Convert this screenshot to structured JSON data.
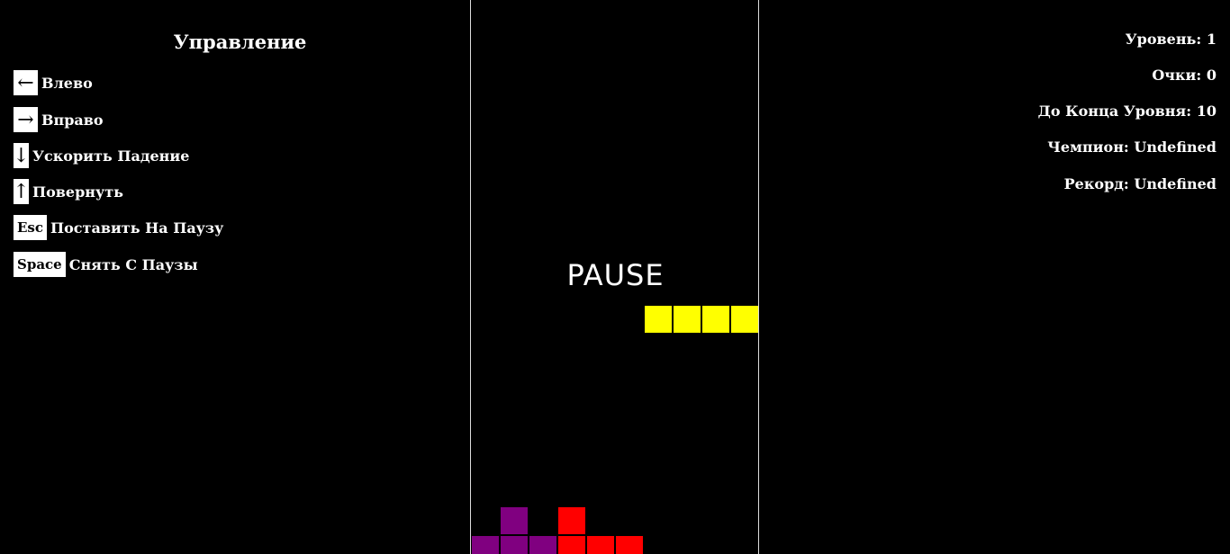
{
  "controls": {
    "title": "Управление",
    "items": [
      {
        "key": "←",
        "label": "Влево"
      },
      {
        "key": "→",
        "label": "Вправо"
      },
      {
        "key": "↓",
        "label": "Ускорить Падение"
      },
      {
        "key": "↑",
        "label": "Повернуть"
      },
      {
        "key": "Esc",
        "label": "Поставить На Паузу"
      },
      {
        "key": "Space",
        "label": "Снять С Паузы"
      }
    ]
  },
  "board": {
    "status": "PAUSE",
    "columns": 10,
    "cells": [
      {
        "col": 6,
        "row": 10.6,
        "color": "#ffff00"
      },
      {
        "col": 7,
        "row": 10.6,
        "color": "#ffff00"
      },
      {
        "col": 8,
        "row": 10.6,
        "color": "#ffff00"
      },
      {
        "col": 9,
        "row": 10.6,
        "color": "#ffff00"
      },
      {
        "col": 1,
        "row": 17.6,
        "color": "#800080"
      },
      {
        "col": 3,
        "row": 17.6,
        "color": "#ff0000"
      },
      {
        "col": 0,
        "row": 18.6,
        "color": "#800080"
      },
      {
        "col": 1,
        "row": 18.6,
        "color": "#800080"
      },
      {
        "col": 2,
        "row": 18.6,
        "color": "#800080"
      },
      {
        "col": 3,
        "row": 18.6,
        "color": "#ff0000"
      },
      {
        "col": 4,
        "row": 18.6,
        "color": "#ff0000"
      },
      {
        "col": 5,
        "row": 18.6,
        "color": "#ff0000"
      }
    ]
  },
  "stats": {
    "level": "Уровень: 1",
    "score": "Очки: 0",
    "to_level_end": "До Конца Уровня: 10",
    "champion": "Чемпион: Undefined",
    "record": "Рекорд: Undefined"
  }
}
